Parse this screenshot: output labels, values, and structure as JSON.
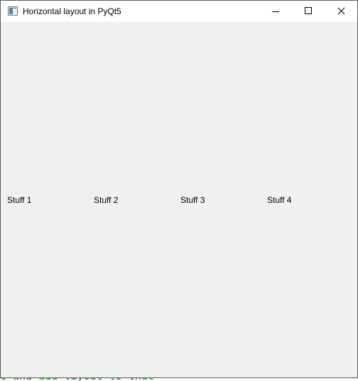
{
  "window": {
    "title": "Horizontal layout in PyQt5",
    "icon": "app-window-icon",
    "controls": {
      "minimize": "minimize-icon",
      "maximize": "maximize-icon",
      "close": "close-icon"
    }
  },
  "layout": {
    "labels": [
      "Stuff 1",
      "Stuff 2",
      "Stuff 3",
      "Stuff 4"
    ]
  },
  "background": {
    "code_line": "e and add layout to that"
  },
  "colors": {
    "client_background": "#f0f0f0",
    "titlebar_background": "#ffffff",
    "code_text": "#1f6f1f"
  }
}
